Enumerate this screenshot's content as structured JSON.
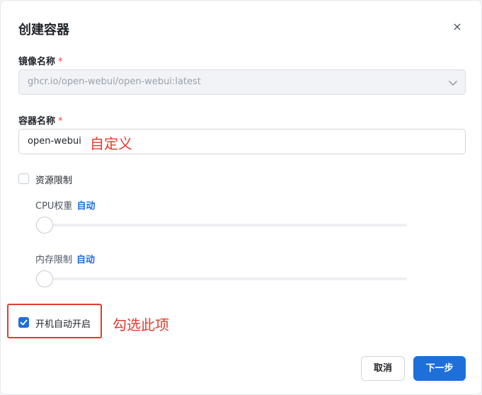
{
  "dialog": {
    "title": "创建容器",
    "close_glyph": "×"
  },
  "image_field": {
    "label": "镜像名称",
    "required_mark": "*",
    "value": "ghcr.io/open-webui/open-webui:latest",
    "disabled": true
  },
  "container_field": {
    "label": "容器名称",
    "required_mark": "*",
    "value": "open-webui"
  },
  "annotations": {
    "custom_note": "自定义",
    "check_note": "勾选此项",
    "color": "#e23b2e"
  },
  "resource_limit": {
    "label": "资源限制",
    "checked": false,
    "cpu": {
      "label": "CPU权重",
      "mode": "自动",
      "level": 0
    },
    "memory": {
      "label": "内存限制",
      "mode": "自动",
      "level": 0
    }
  },
  "autostart": {
    "label": "开机自动开启",
    "checked": true
  },
  "footer": {
    "cancel_label": "取消",
    "next_label": "下一步"
  },
  "colors": {
    "primary": "#1e6fd9",
    "required": "#ef4444"
  }
}
